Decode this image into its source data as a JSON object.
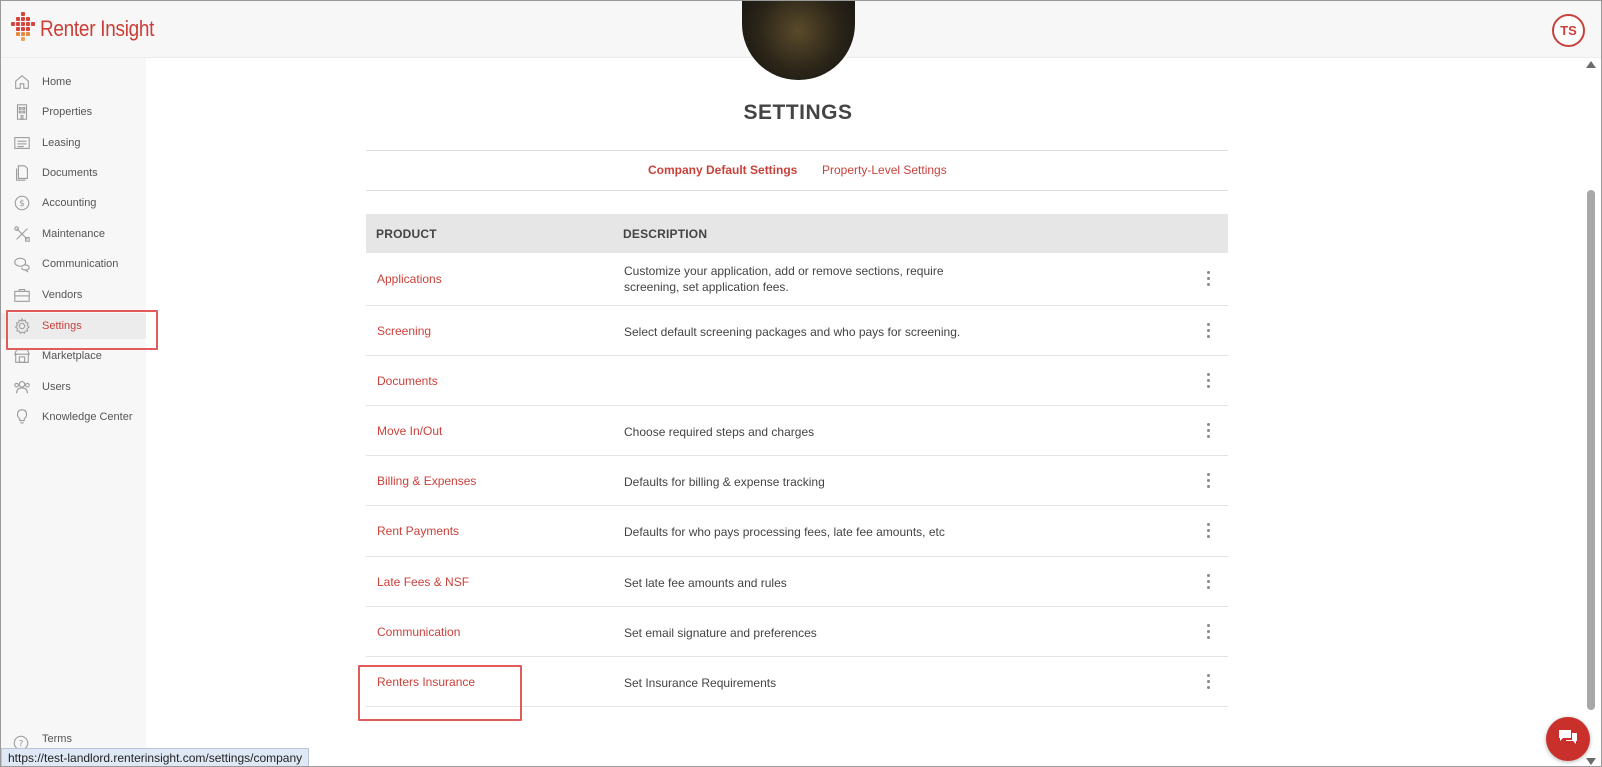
{
  "brand": {
    "name": "Renter Insight",
    "accent": "#c9413b"
  },
  "user": {
    "initials": "TS"
  },
  "sidebar": {
    "items": [
      {
        "label": "Home",
        "icon": "home-icon"
      },
      {
        "label": "Properties",
        "icon": "building-icon"
      },
      {
        "label": "Leasing",
        "icon": "list-icon"
      },
      {
        "label": "Documents",
        "icon": "document-icon"
      },
      {
        "label": "Accounting",
        "icon": "dollar-icon"
      },
      {
        "label": "Maintenance",
        "icon": "tools-icon"
      },
      {
        "label": "Communication",
        "icon": "chat-bubbles-icon"
      },
      {
        "label": "Vendors",
        "icon": "briefcase-icon"
      },
      {
        "label": "Settings",
        "icon": "gear-icon",
        "active": true
      },
      {
        "label": "Marketplace",
        "icon": "storefront-icon"
      },
      {
        "label": "Users",
        "icon": "users-icon"
      },
      {
        "label": "Knowledge Center",
        "icon": "lightbulb-icon"
      }
    ],
    "terms": "Terms"
  },
  "main": {
    "title": "SETTINGS",
    "tabs": [
      {
        "label": "Company Default Settings",
        "active": true
      },
      {
        "label": "Property-Level Settings",
        "active": false
      }
    ],
    "table": {
      "headers": [
        "PRODUCT",
        "DESCRIPTION"
      ],
      "rows": [
        {
          "product": "Applications",
          "description": "Customize your application, add or remove sections, require screening, set application fees."
        },
        {
          "product": "Screening",
          "description": "Select default screening packages and who pays for screening."
        },
        {
          "product": "Documents",
          "description": ""
        },
        {
          "product": "Move In/Out",
          "description": "Choose required steps and charges"
        },
        {
          "product": "Billing & Expenses",
          "description": "Defaults for billing & expense tracking"
        },
        {
          "product": "Rent Payments",
          "description": "Defaults for who pays processing fees, late fee amounts, etc"
        },
        {
          "product": "Late Fees & NSF",
          "description": "Set late fee amounts and rules"
        },
        {
          "product": "Communication",
          "description": "Set email signature and preferences"
        },
        {
          "product": "Renters Insurance",
          "description": "Set Insurance Requirements"
        }
      ]
    }
  },
  "status_url": "https://test-landlord.renterinsight.com/settings/company"
}
